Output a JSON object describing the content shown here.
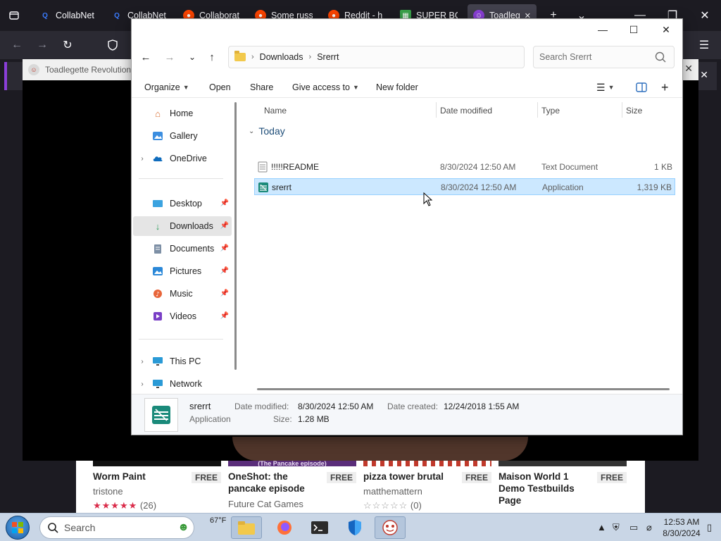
{
  "browser": {
    "tabs": [
      {
        "label": "CollabNet",
        "icon": "search-icon",
        "color": "#3a7bfd"
      },
      {
        "label": "CollabNet",
        "icon": "search-icon",
        "color": "#3a7bfd"
      },
      {
        "label": "Collaborat",
        "icon": "reddit-icon",
        "color": "#ff4500"
      },
      {
        "label": "Some russi",
        "icon": "reddit-icon",
        "color": "#ff4500"
      },
      {
        "label": "Reddit - h",
        "icon": "reddit-icon",
        "color": "#ff4500"
      },
      {
        "label": "SUPER BO",
        "icon": "game-icon",
        "color": "#3aa34b"
      },
      {
        "label": "Toadleg",
        "icon": "toad-icon",
        "color": "#8b3fd9"
      }
    ],
    "new_tab": "+",
    "list_tabs": "⌄",
    "minimize": "—",
    "maximize": "❐",
    "close": "✕"
  },
  "game_page": {
    "title": "Toadlegette Revolution",
    "games": [
      {
        "title": "Worm Paint",
        "price": "FREE",
        "author": "tristone",
        "stars": "★★★★★",
        "rating_count": "(26)",
        "thumb_color": "#111111"
      },
      {
        "title": "OneShot: the pancake episode",
        "price": "FREE",
        "author": "Future Cat Games",
        "stars": "",
        "rating_count": "",
        "thumb_color": "#5a2d7a",
        "thumb_caption": "(The Pancake episode)"
      },
      {
        "title": "pizza tower brutal",
        "price": "FREE",
        "author": "matthemattern",
        "stars": "☆☆☆☆☆",
        "rating_count": "(0)",
        "thumb_color": "#c0392b"
      },
      {
        "title": "Maison World 1 Demo Testbuilds Page",
        "price": "FREE",
        "author": "",
        "stars": "",
        "rating_count": "",
        "thumb_color": "#333333"
      }
    ]
  },
  "explorer": {
    "window_controls": {
      "minimize": "—",
      "maximize": "☐",
      "close": "✕"
    },
    "nav": {
      "back": "←",
      "forward": "→",
      "recent": "⌄",
      "up": "↑"
    },
    "breadcrumb": [
      "Downloads",
      "Srerrt"
    ],
    "breadcrumb_sep": "›",
    "search_placeholder": "Search Srerrt",
    "toolbar": {
      "organize": "Organize",
      "open": "Open",
      "share": "Share",
      "give_access": "Give access to",
      "new_folder": "New folder"
    },
    "sidebar": {
      "groups": [
        [
          {
            "label": "Home",
            "icon": "home-icon",
            "expandable": false,
            "pinned": false
          },
          {
            "label": "Gallery",
            "icon": "gallery-icon",
            "expandable": false,
            "pinned": false
          },
          {
            "label": "OneDrive",
            "icon": "onedrive-icon",
            "expandable": true,
            "pinned": false
          }
        ],
        [
          {
            "label": "Desktop",
            "icon": "desktop-icon",
            "expandable": false,
            "pinned": true
          },
          {
            "label": "Downloads",
            "icon": "downloads-icon",
            "expandable": false,
            "pinned": true,
            "selected": true
          },
          {
            "label": "Documents",
            "icon": "documents-icon",
            "expandable": false,
            "pinned": true
          },
          {
            "label": "Pictures",
            "icon": "pictures-icon",
            "expandable": false,
            "pinned": true
          },
          {
            "label": "Music",
            "icon": "music-icon",
            "expandable": false,
            "pinned": true
          },
          {
            "label": "Videos",
            "icon": "videos-icon",
            "expandable": false,
            "pinned": true
          }
        ],
        [
          {
            "label": "This PC",
            "icon": "this-pc-icon",
            "expandable": true,
            "pinned": false
          },
          {
            "label": "Network",
            "icon": "network-icon",
            "expandable": true,
            "pinned": false
          }
        ]
      ]
    },
    "columns": {
      "name": "Name",
      "date": "Date modified",
      "type": "Type",
      "size": "Size"
    },
    "group_label": "Today",
    "files": [
      {
        "name": "!!!!!README",
        "date": "8/30/2024 12:50 AM",
        "type": "Text Document",
        "size": "1 KB",
        "icon": "text-file-icon",
        "selected": false
      },
      {
        "name": "srerrt",
        "date": "8/30/2024 12:50 AM",
        "type": "Application",
        "size": "1,319 KB",
        "icon": "application-icon",
        "selected": true
      }
    ],
    "details": {
      "name": "srerrt",
      "kind": "Application",
      "modified_label": "Date modified:",
      "modified": "8/30/2024 12:50 AM",
      "created_label": "Date created:",
      "created": "12/24/2018 1:55 AM",
      "size_label": "Size:",
      "size": "1.28 MB"
    }
  },
  "taskbar": {
    "search_label": "Search",
    "weather": "67°F",
    "clock_time": "12:53 AM",
    "clock_date": "8/30/2024",
    "apps": [
      "file-explorer-icon",
      "firefox-icon",
      "terminal-icon",
      "defender-icon",
      "toad-app-icon"
    ]
  }
}
